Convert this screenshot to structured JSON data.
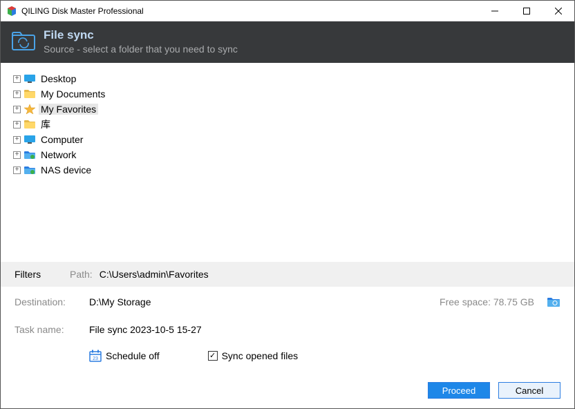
{
  "titlebar": {
    "title": "QILING Disk Master Professional"
  },
  "header": {
    "title": "File sync",
    "subtitle": "Source - select a folder that you need to sync"
  },
  "tree": {
    "items": [
      {
        "label": "Desktop",
        "icon": "monitor",
        "selected": false
      },
      {
        "label": "My Documents",
        "icon": "folder",
        "selected": false
      },
      {
        "label": "My Favorites",
        "icon": "star",
        "selected": true
      },
      {
        "label": "库",
        "icon": "folder",
        "selected": false
      },
      {
        "label": "Computer",
        "icon": "monitor",
        "selected": false
      },
      {
        "label": "Network",
        "icon": "network",
        "selected": false
      },
      {
        "label": "NAS device",
        "icon": "network",
        "selected": false
      }
    ]
  },
  "filters": {
    "label": "Filters",
    "path_label": "Path:",
    "path_value": "C:\\Users\\admin\\Favorites"
  },
  "destination": {
    "label": "Destination:",
    "value": "D:\\My Storage",
    "free_space": "Free space: 78.75 GB"
  },
  "task": {
    "label": "Task name:",
    "value": "File sync 2023-10-5 15-27"
  },
  "options": {
    "schedule_label": "Schedule off",
    "sync_opened_label": "Sync opened files",
    "sync_opened_checked": true
  },
  "buttons": {
    "proceed": "Proceed",
    "cancel": "Cancel"
  }
}
